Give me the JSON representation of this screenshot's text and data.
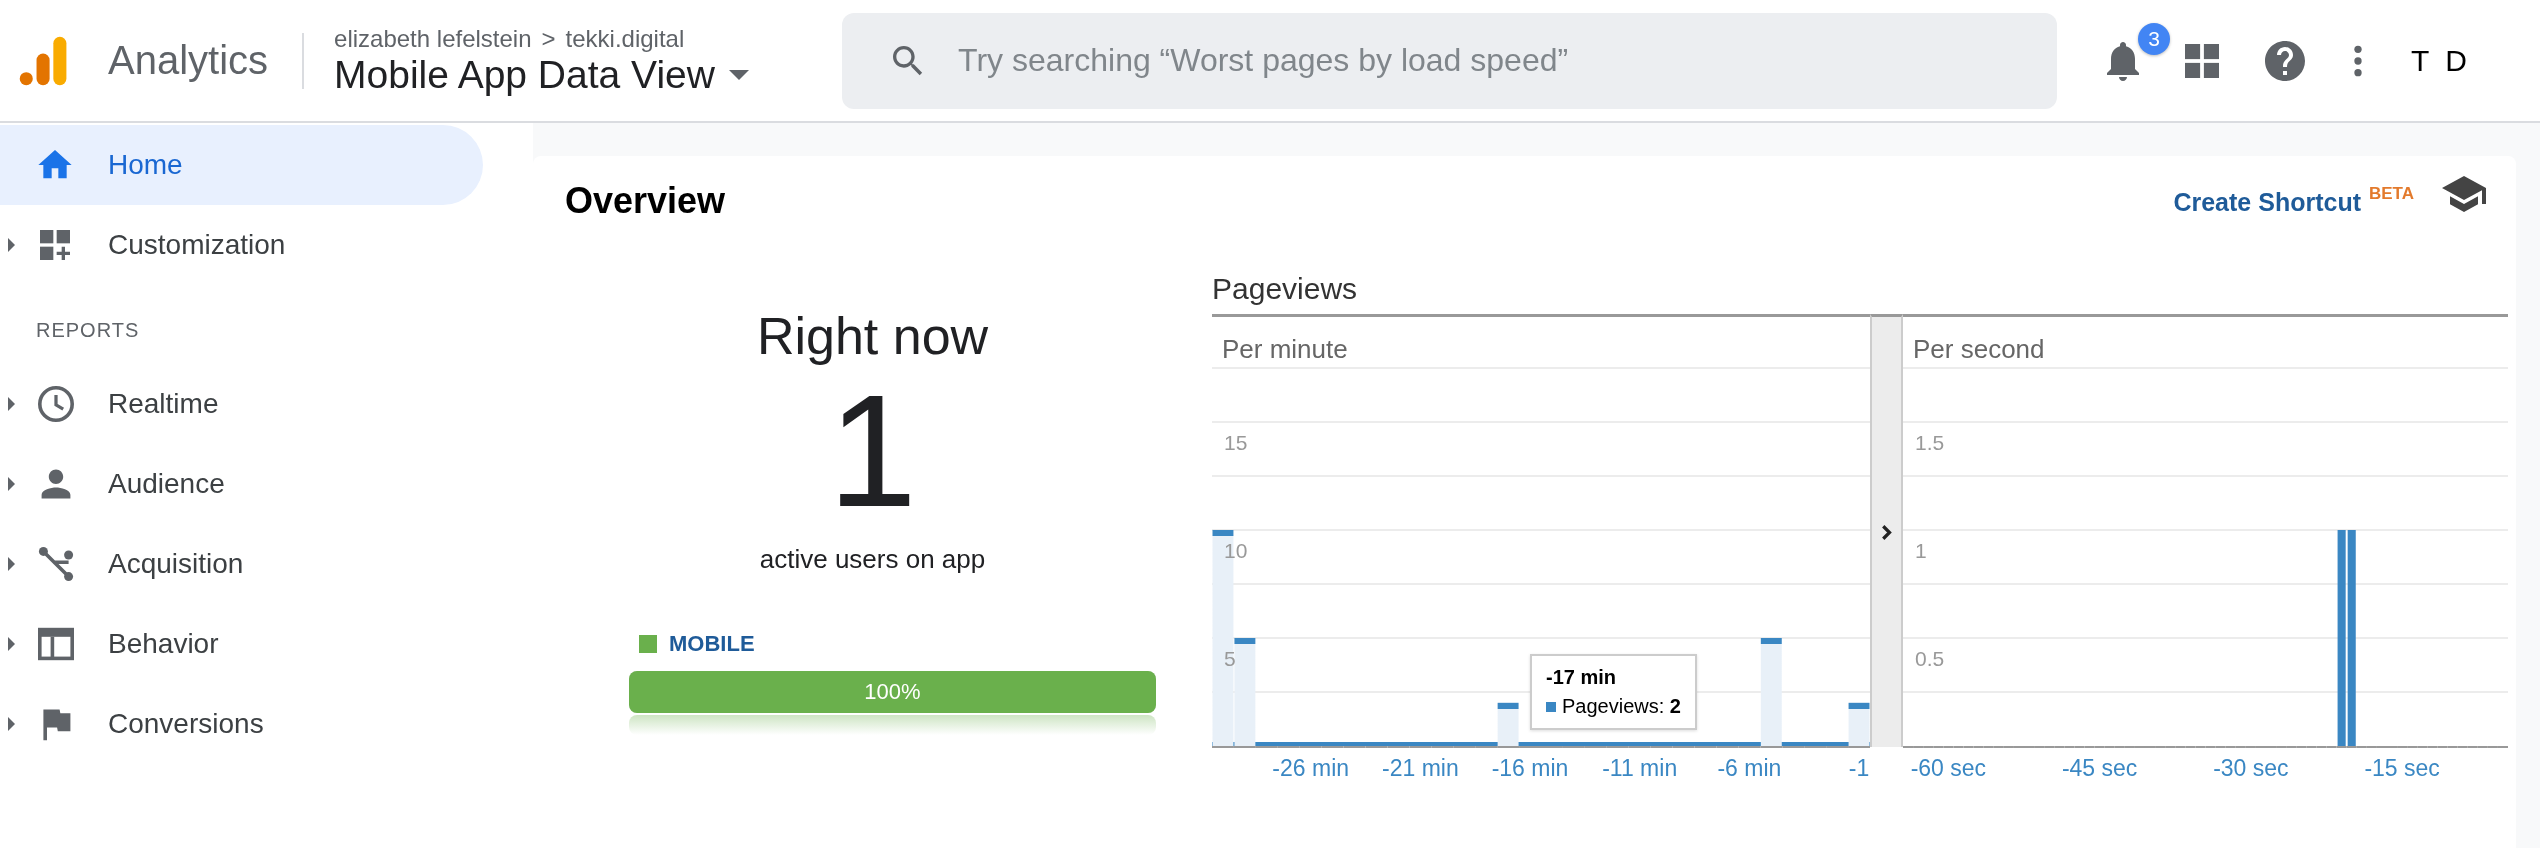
{
  "header": {
    "product": "Analytics",
    "breadcrumb": {
      "account": "elizabeth lefelstein",
      "separator": ">",
      "property": "tekki.digital"
    },
    "view": "Mobile App Data View",
    "search": {
      "placeholder": "Try searching “Worst pages by load speed”"
    },
    "notifications": "3",
    "avatar": "T D"
  },
  "sidebar": {
    "items": [
      {
        "label": "Home",
        "selected": true,
        "expandable": false
      },
      {
        "label": "Customization",
        "selected": false,
        "expandable": true
      }
    ],
    "section": {
      "title": "REPORTS",
      "items": [
        {
          "label": "Realtime",
          "selected": false,
          "expandable": true
        },
        {
          "label": "Audience",
          "selected": false,
          "expandable": true
        },
        {
          "label": "Acquisition",
          "selected": false,
          "expandable": true
        },
        {
          "label": "Behavior",
          "selected": false,
          "expandable": true
        },
        {
          "label": "Conversions",
          "selected": false,
          "expandable": true
        }
      ]
    }
  },
  "overview": {
    "title": "Overview",
    "shortcut": "Create Shortcut",
    "shortcut_badge": "BETA"
  },
  "realtime": {
    "heading": "Right now",
    "count": "1",
    "caption": "active users on app",
    "devices": [
      {
        "label": "MOBILE",
        "color": "#6ab04c",
        "level": 1,
        "reading": "100%"
      }
    ]
  },
  "pageviews": {
    "title": "Pageviews",
    "tooltip": {
      "title": "-17 min",
      "text": "Pageviews: **2**"
    },
    "panels": [
      {
        "kind": "capped",
        "chart_data": {
          "type": "bar",
          "title": "Per minute",
          "grid": true,
          "xlim": [
            -30.5,
            -0.5
          ],
          "ylim": [
            0,
            20
          ],
          "yticks": [
            5,
            10,
            15
          ],
          "x": [
            -30,
            -29,
            -28,
            -27,
            -26,
            -25,
            -24,
            -23,
            -22,
            -21,
            -20,
            -19,
            -18,
            -17,
            -16,
            -15,
            -14,
            -13,
            -12,
            -11,
            -10,
            -9,
            -8,
            -7,
            -6,
            -5,
            -4,
            -3,
            -2,
            -1
          ],
          "xticks": [
            {
              "value": -26,
              "label": "-26 min"
            },
            {
              "value": -21,
              "label": "-21 min"
            },
            {
              "value": -16,
              "label": "-16 min"
            },
            {
              "value": -11,
              "label": "-11 min"
            },
            {
              "value": -6,
              "label": "-6 min"
            },
            {
              "value": -1,
              "label": "-1"
            }
          ],
          "values": [
            10,
            5,
            0,
            0,
            0,
            0,
            0,
            0,
            0,
            0,
            0,
            0,
            0,
            2,
            0,
            0,
            0,
            0,
            0,
            0,
            0,
            0,
            0,
            0,
            0,
            5,
            0,
            0,
            0,
            2
          ]
        }
      },
      {
        "kind": "solid",
        "chart_data": {
          "type": "bar",
          "title": "Per second",
          "grid": true,
          "xlim": [
            -64.5,
            -4.5
          ],
          "ylim": [
            0,
            2
          ],
          "yticks": [
            0.5,
            1,
            1.5
          ],
          "x": [
            -64,
            -63,
            -62,
            -61,
            -60,
            -59,
            -58,
            -57,
            -56,
            -55,
            -54,
            -53,
            -52,
            -51,
            -50,
            -49,
            -48,
            -47,
            -46,
            -45,
            -44,
            -43,
            -42,
            -41,
            -40,
            -39,
            -38,
            -37,
            -36,
            -35,
            -34,
            -33,
            -32,
            -31,
            -30,
            -29,
            -28,
            -27,
            -26,
            -25,
            -24,
            -23,
            -22,
            -21,
            -20,
            -19,
            -18,
            -17,
            -16,
            -15,
            -14,
            -13,
            -12,
            -11,
            -10,
            -9,
            -8,
            -7,
            -6,
            -5
          ],
          "xticks": [
            {
              "value": -60,
              "label": "-60 sec"
            },
            {
              "value": -45,
              "label": "-45 sec"
            },
            {
              "value": -30,
              "label": "-30 sec"
            },
            {
              "value": -15,
              "label": "-15 sec"
            }
          ],
          "values": [
            0,
            0,
            0,
            0,
            0,
            0,
            0,
            0,
            0,
            0,
            0,
            0,
            0,
            0,
            0,
            0,
            0,
            0,
            0,
            0,
            0,
            0,
            0,
            0,
            0,
            0,
            0,
            0,
            0,
            0,
            0,
            0,
            0,
            0,
            0,
            0,
            0,
            0,
            0,
            0,
            0,
            0,
            0,
            1,
            1,
            0,
            0,
            0,
            0,
            0,
            0,
            0,
            0,
            0,
            0,
            0,
            0,
            0,
            0,
            0
          ]
        }
      }
    ]
  }
}
